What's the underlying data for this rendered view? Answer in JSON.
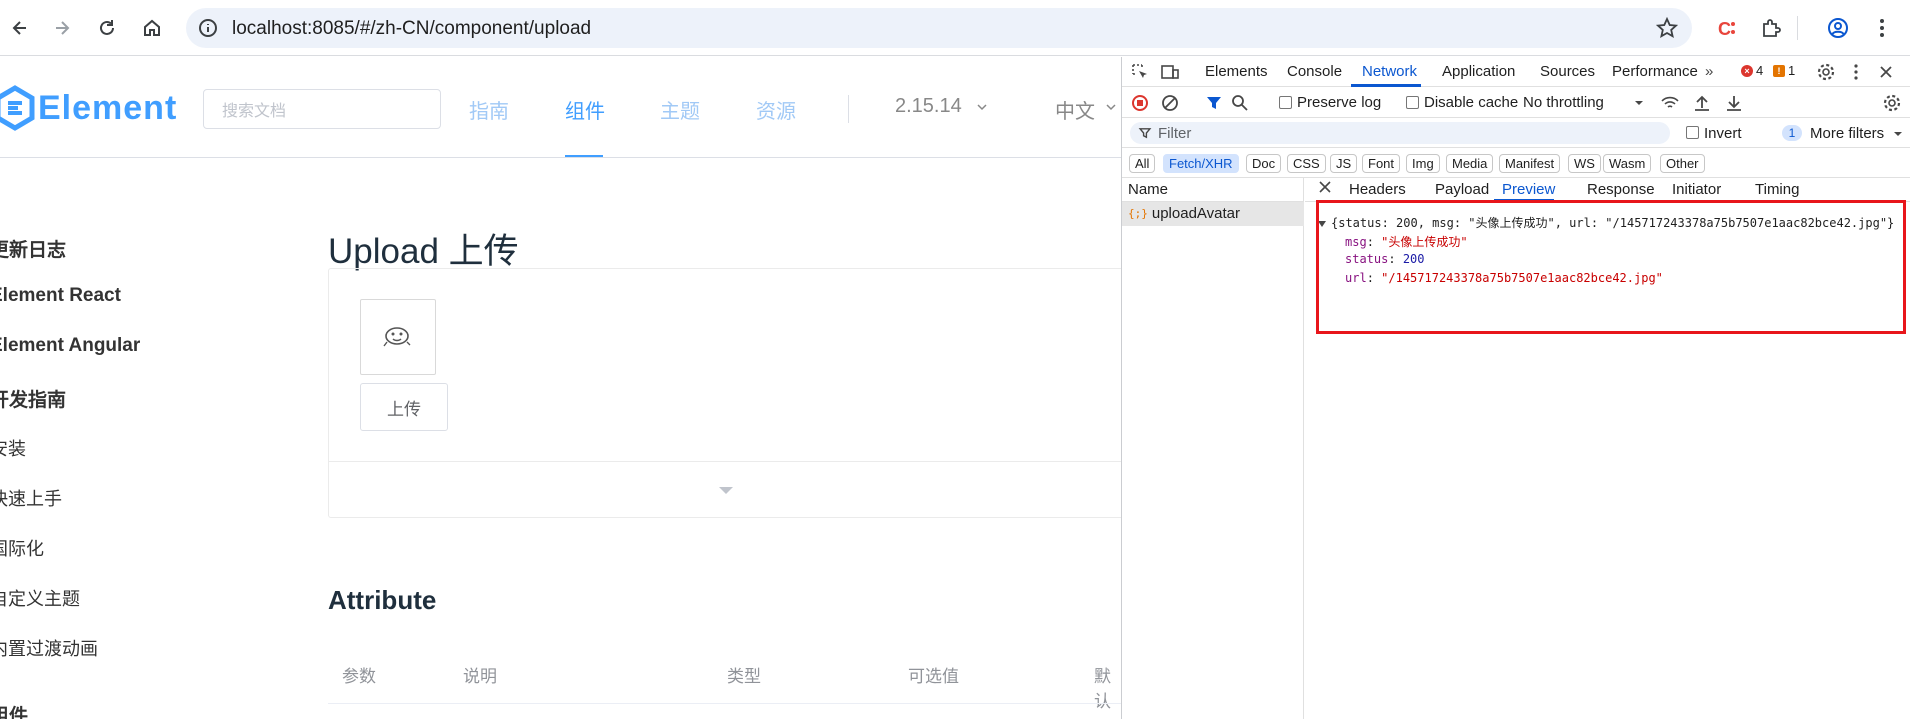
{
  "browser": {
    "url": "localhost:8085/#/zh-CN/component/upload"
  },
  "site": {
    "logo_text": "Element",
    "search_placeholder": "搜索文档",
    "nav": [
      "指南",
      "组件",
      "主题",
      "资源"
    ],
    "active_nav": "组件",
    "version": "2.15.14",
    "language": "中文"
  },
  "sidebar": {
    "items": [
      {
        "label": "更新日志",
        "group": true
      },
      {
        "label": "Element React",
        "group": true
      },
      {
        "label": "Element Angular",
        "group": true
      },
      {
        "label": "开发指南",
        "group": true
      },
      {
        "label": "安装",
        "group": false
      },
      {
        "label": "快速上手",
        "group": false
      },
      {
        "label": "国际化",
        "group": false
      },
      {
        "label": "自定义主题",
        "group": false
      },
      {
        "label": "内置过渡动画",
        "group": false
      },
      {
        "label": "组件",
        "group": true
      }
    ]
  },
  "content": {
    "title": "Upload 上传",
    "upload_button": "上传",
    "attribute_title": "Attribute",
    "table_headers": [
      "参数",
      "说明",
      "类型",
      "可选值",
      "默认"
    ]
  },
  "devtools": {
    "tabs": [
      "Elements",
      "Console",
      "Network",
      "Application",
      "Sources",
      "Performance"
    ],
    "active_tab": "Network",
    "error_count": "4",
    "warning_count": "1",
    "preserve_log": "Preserve log",
    "disable_cache": "Disable cache",
    "throttling": "No throttling",
    "filter_placeholder": "Filter",
    "invert": "Invert",
    "more_filters_count": "1",
    "more_filters": "More filters",
    "type_filters": [
      "All",
      "Fetch/XHR",
      "Doc",
      "CSS",
      "JS",
      "Font",
      "Img",
      "Media",
      "Manifest",
      "WS",
      "Wasm",
      "Other"
    ],
    "active_type": "Fetch/XHR",
    "name_header": "Name",
    "requests": [
      "uploadAvatar"
    ],
    "detail_tabs": [
      "Headers",
      "Payload",
      "Preview",
      "Response",
      "Initiator",
      "Timing"
    ],
    "active_detail_tab": "Preview",
    "preview": {
      "summary": "{status: 200, msg: \"头像上传成功\", url: \"/145717243378a75b7507e1aac82bce42.jpg\"}",
      "msg_key": "msg",
      "msg_value": "\"头像上传成功\"",
      "status_key": "status",
      "status_value": "200",
      "url_key": "url",
      "url_value": "\"/145717243378a75b7507e1aac82bce42.jpg\""
    }
  },
  "colors": {
    "element_blue": "#409eff",
    "devtools_blue": "#0b57d0",
    "highlight_red": "#e8161b"
  }
}
